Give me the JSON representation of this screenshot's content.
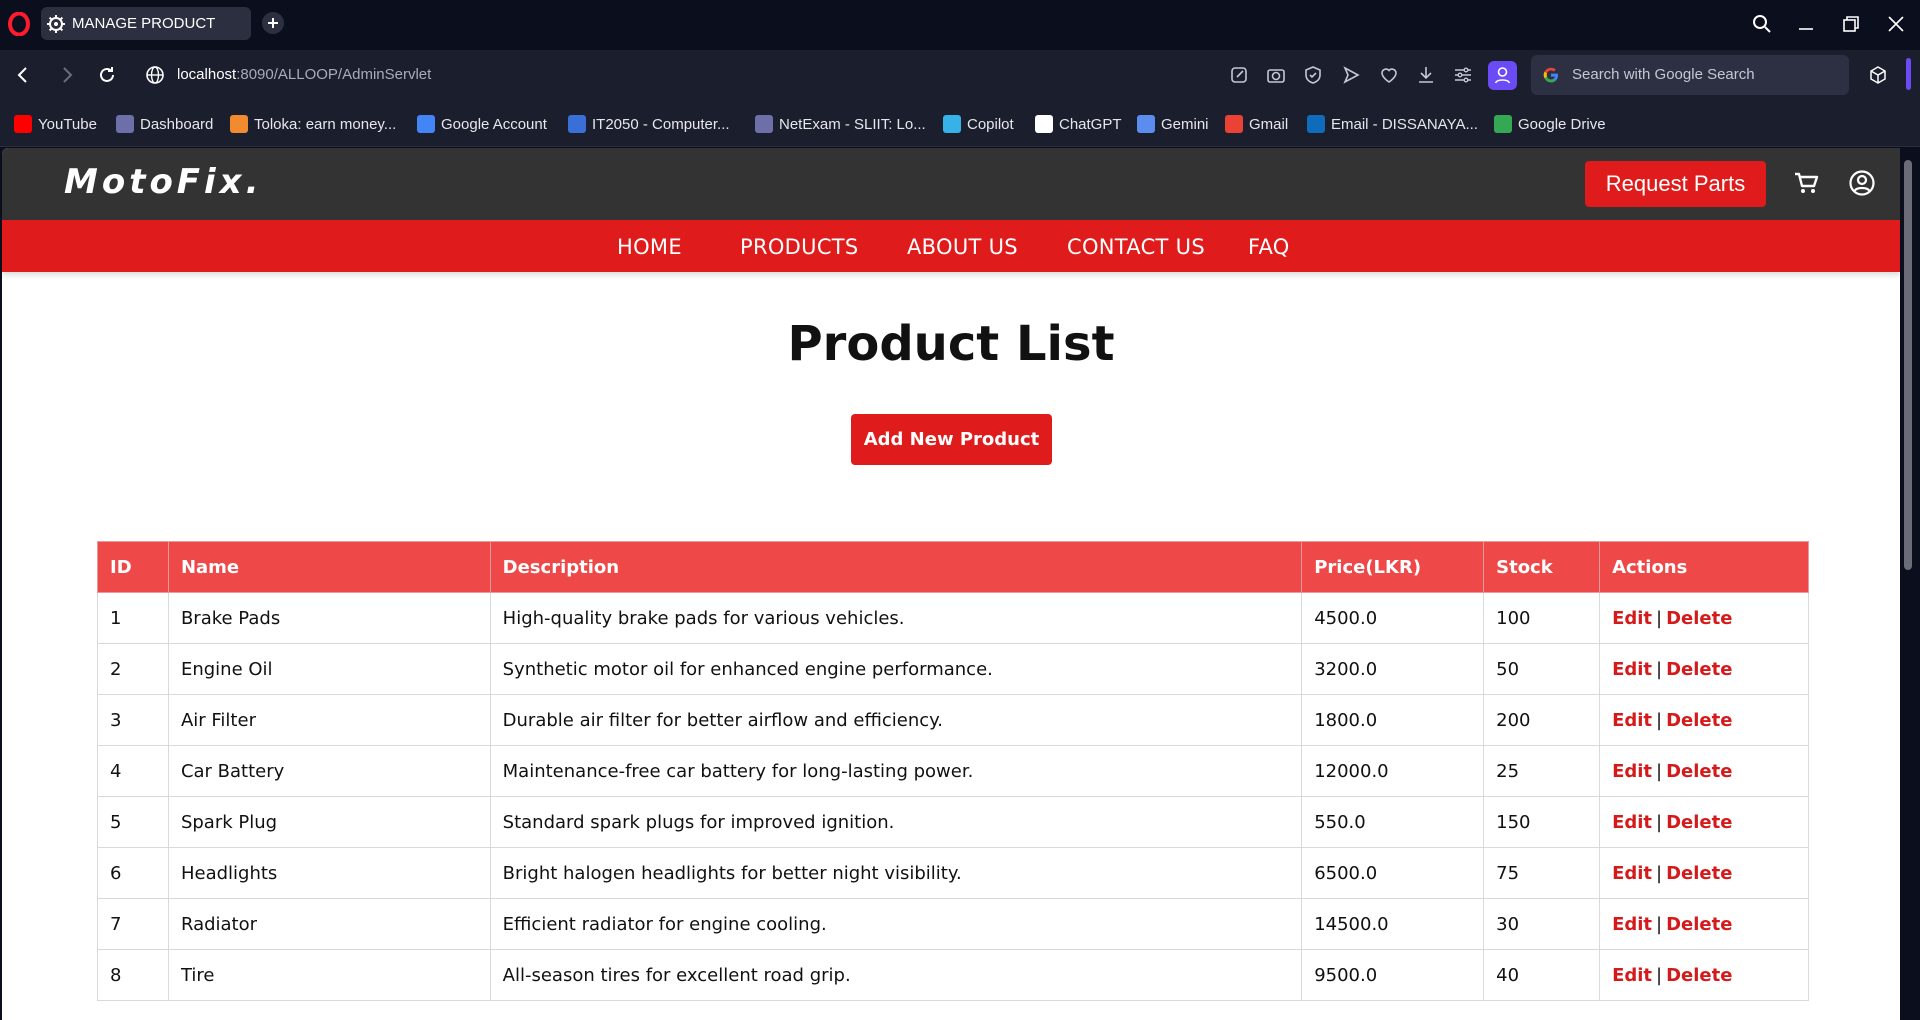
{
  "browser": {
    "tab_title": "MANAGE PRODUCT",
    "url_host": "localhost",
    "url_rest": ":8090/ALLOOP/AdminServlet",
    "search_placeholder": "Search with Google Search",
    "bookmarks": [
      {
        "label": "YouTube",
        "color": "#ff0000"
      },
      {
        "label": "Dashboard",
        "color": "#6c6fa8"
      },
      {
        "label": "Toloka: earn money...",
        "color": "#f28b30"
      },
      {
        "label": "Google Account",
        "color": "#4285f4"
      },
      {
        "label": "IT2050 - Computer...",
        "color": "#3b6fd8"
      },
      {
        "label": "NetExam - SLIIT: Lo...",
        "color": "#6c6fa8"
      },
      {
        "label": "Copilot",
        "color": "#36b2e8"
      },
      {
        "label": "ChatGPT",
        "color": "#ffffff"
      },
      {
        "label": "Gemini",
        "color": "#5b8def"
      },
      {
        "label": "Gmail",
        "color": "#ea4335"
      },
      {
        "label": "Email - DISSANAYA...",
        "color": "#0f6cbd"
      },
      {
        "label": "Google Drive",
        "color": "#34a853"
      }
    ]
  },
  "site": {
    "brand": "MotoFix.",
    "request_button": "Request Parts",
    "nav": [
      "HOME",
      "PRODUCTS",
      "ABOUT US",
      "CONTACT US",
      "FAQ"
    ],
    "accent_color": "#e01b1b"
  },
  "main": {
    "title": "Product List",
    "add_button": "Add New Product",
    "table": {
      "headers": [
        "ID",
        "Name",
        "Description",
        "Price(LKR)",
        "Stock",
        "Actions"
      ],
      "edit_label": "Edit",
      "delete_label": "Delete",
      "separator": "|",
      "rows": [
        {
          "id": "1",
          "name": "Brake Pads",
          "description": "High-quality brake pads for various vehicles.",
          "price": "4500.0",
          "stock": "100"
        },
        {
          "id": "2",
          "name": "Engine Oil",
          "description": "Synthetic motor oil for enhanced engine performance.",
          "price": "3200.0",
          "stock": "50"
        },
        {
          "id": "3",
          "name": "Air Filter",
          "description": "Durable air filter for better airflow and efficiency.",
          "price": "1800.0",
          "stock": "200"
        },
        {
          "id": "4",
          "name": "Car Battery",
          "description": "Maintenance-free car battery for long-lasting power.",
          "price": "12000.0",
          "stock": "25"
        },
        {
          "id": "5",
          "name": "Spark Plug",
          "description": "Standard spark plugs for improved ignition.",
          "price": "550.0",
          "stock": "150"
        },
        {
          "id": "6",
          "name": "Headlights",
          "description": "Bright halogen headlights for better night visibility.",
          "price": "6500.0",
          "stock": "75"
        },
        {
          "id": "7",
          "name": "Radiator",
          "description": "Efficient radiator for engine cooling.",
          "price": "14500.0",
          "stock": "30"
        },
        {
          "id": "8",
          "name": "Tire",
          "description": "All-season tires for excellent road grip.",
          "price": "9500.0",
          "stock": "40"
        }
      ]
    }
  }
}
